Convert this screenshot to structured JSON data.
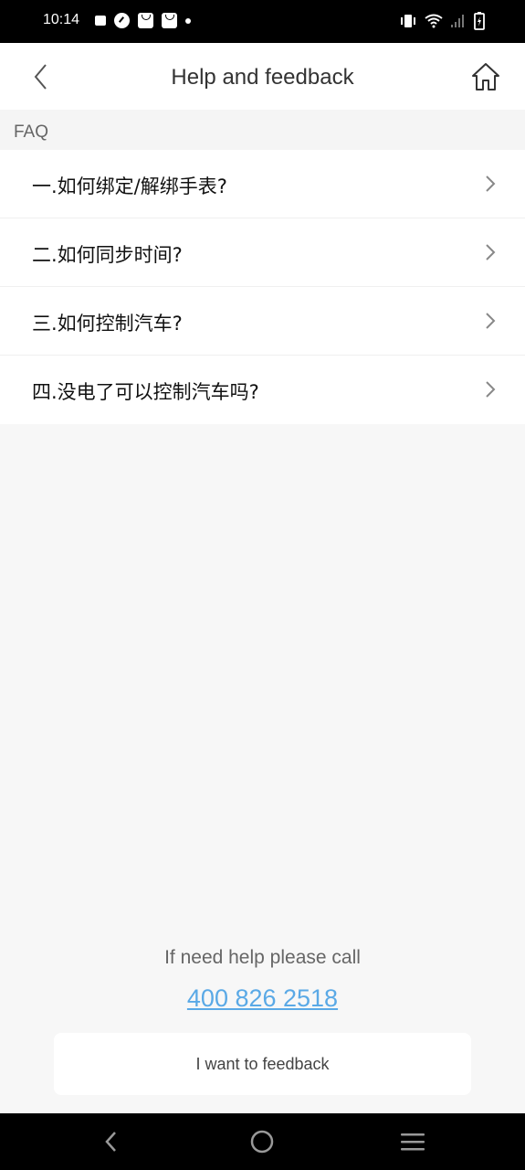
{
  "status_bar": {
    "time": "10:14",
    "left_icons": [
      "notification-square-icon",
      "gauge-icon",
      "shopping-bag-icon",
      "shopping-bag-icon",
      "dot-icon"
    ],
    "right_icons": [
      "vibrate-icon",
      "wifi-icon",
      "signal-icon",
      "battery-charging-icon"
    ]
  },
  "app_bar": {
    "title": "Help and feedback",
    "back_icon": "chevron-left-icon",
    "home_icon": "home-icon"
  },
  "faq": {
    "header": "FAQ",
    "items": [
      {
        "label": "一.如何绑定/解绑手表?"
      },
      {
        "label": "二.如何同步时间?"
      },
      {
        "label": "三.如何控制汽车?"
      },
      {
        "label": "四.没电了可以控制汽车吗?"
      }
    ]
  },
  "footer": {
    "help_text": "If need help please call",
    "phone": "400 826 2518",
    "feedback_button": "I want to feedback"
  },
  "colors": {
    "link": "#5aa9e6",
    "background": "#f7f7f7"
  },
  "nav_bar": {
    "icons": [
      "nav-back-icon",
      "nav-home-icon",
      "nav-recents-icon"
    ]
  }
}
